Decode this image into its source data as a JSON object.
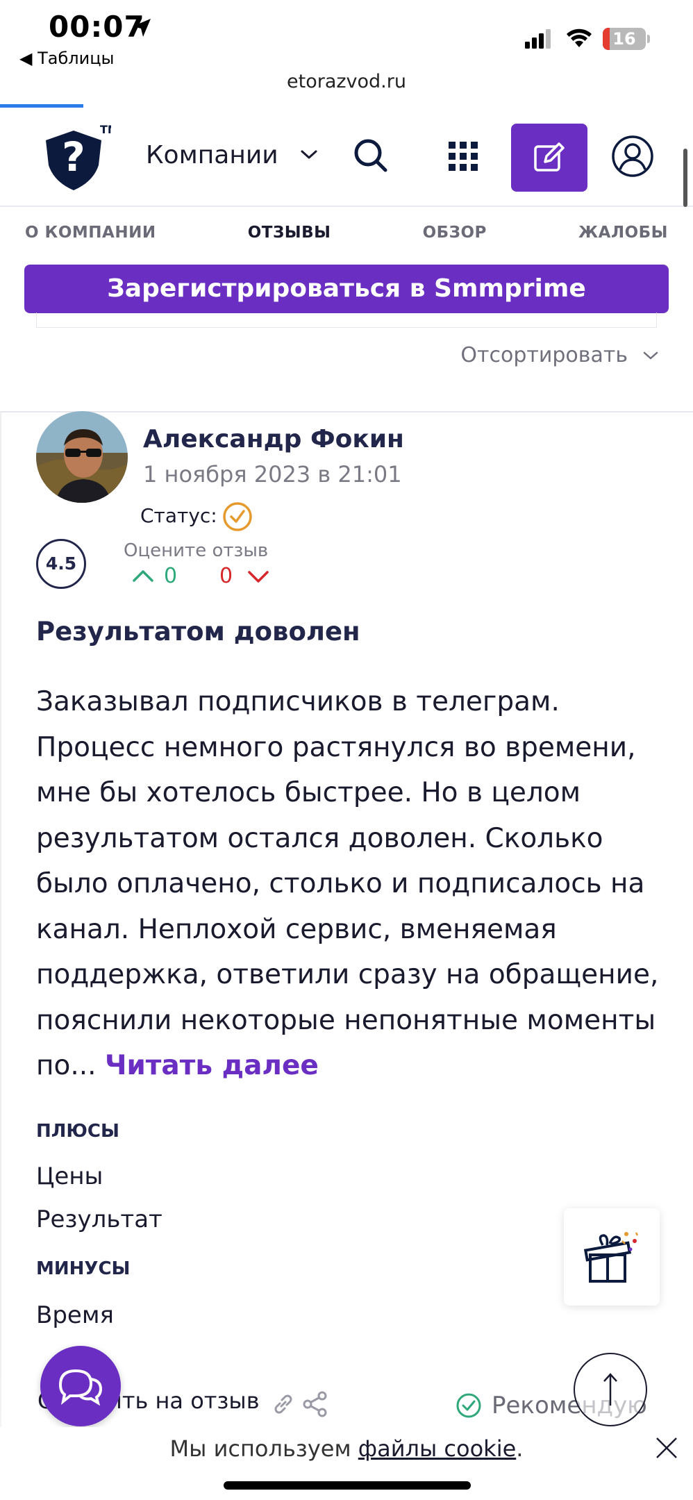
{
  "status_bar": {
    "time": "00:07",
    "back_label": "◀ Таблицы",
    "battery": "16",
    "battery_level": 0.16
  },
  "browser": {
    "url": "etorazvod.ru"
  },
  "header": {
    "logo_tm": "TM",
    "nav_select": "Компании"
  },
  "tabs": [
    {
      "label": "О КОМПАНИИ"
    },
    {
      "label": "ОТЗЫВЫ"
    },
    {
      "label": "ОБЗОР"
    },
    {
      "label": "ЖАЛОБЫ"
    }
  ],
  "register_button": "Зарегистрироваться в Smmprime",
  "sort_label": "Отсортировать",
  "review": {
    "author": "Александр Фокин",
    "date": "1 ноября 2023 в 21:01",
    "status_label": "Статус:",
    "rating": "4.5",
    "rate_label": "Оцените отзыв",
    "votes_up": "0",
    "votes_down": "0",
    "title": "Результатом доволен",
    "body": "Заказывал подписчиков в телеграм. Процесс немного растянулся во времени, мне бы хотелось быстрее. Но в целом результатом остался доволен. Сколько было оплачено, столько и подписалось на канал. Неплохой сервис, вменяемая поддержка, ответили сразу на обращение, пояснили некоторые непонятные моменты по...",
    "read_more": "Читать далее",
    "pros_label": "ПЛЮСЫ",
    "pros": [
      "Цены",
      "Результат"
    ],
    "cons_label": "МИНУСЫ",
    "cons": [
      "Время"
    ],
    "reply_link": "Ответить на отзыв",
    "recommend": "Рекомендую"
  },
  "cookie": {
    "prefix": "Мы используем ",
    "link": "файлы cookie",
    "suffix": "."
  },
  "colors": {
    "accent": "#6a2fc2",
    "navy": "#22264b",
    "up": "#2ea87a",
    "down": "#d6282a",
    "status_ok": "#e69a2e"
  }
}
